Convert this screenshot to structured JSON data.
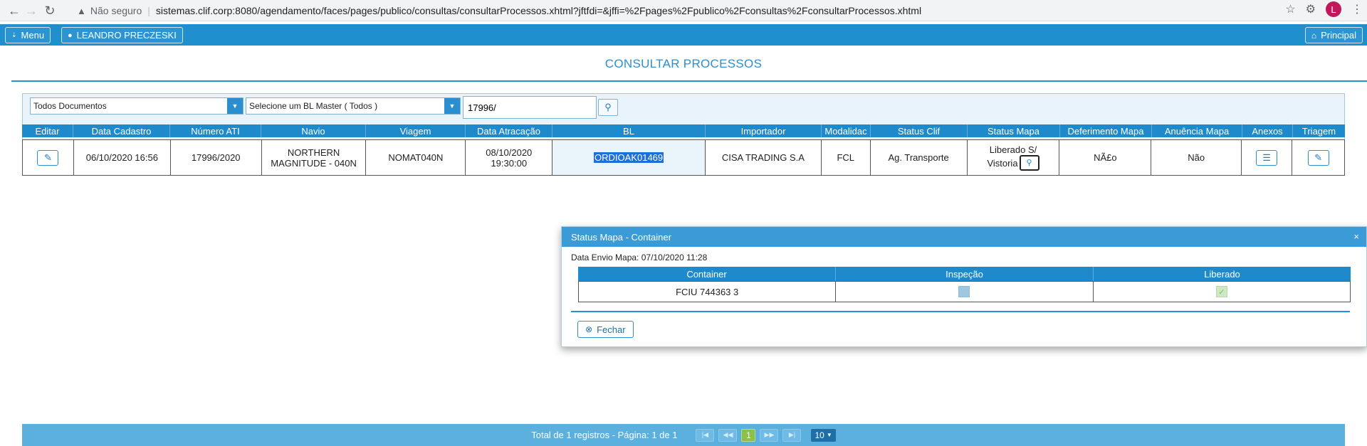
{
  "browser": {
    "security": "Não seguro",
    "url": "sistemas.clif.corp:8080/agendamento/faces/pages/publico/consultas/consultarProcessos.xhtml?jftfdi=&jffi=%2Fpages%2Fpublico%2Fconsultas%2FconsultarProcessos.xhtml",
    "avatar_letter": "L"
  },
  "appbar": {
    "menu_label": "Menu",
    "user_label": "LEANDRO PRECZESKI",
    "principal_label": "Principal"
  },
  "page": {
    "title": "CONSULTAR PROCESSOS"
  },
  "filters": {
    "doc_type": "Todos Documentos",
    "bl_master": "Selecione um BL Master ( Todos )",
    "search_value": "17996/"
  },
  "grid": {
    "columns": [
      "Editar",
      "Data Cadastro",
      "Número ATI",
      "Navio",
      "Viagem",
      "Data Atracação",
      "BL",
      "Importador",
      "Modalidac",
      "Status Clif",
      "Status Mapa",
      "Deferimento Mapa",
      "Anuência Mapa",
      "Anexos",
      "Triagem"
    ],
    "row": {
      "data_cadastro": "06/10/2020 16:56",
      "numero_ati": "17996/2020",
      "navio_line1": "NORTHERN",
      "navio_line2": "MAGNITUDE - 040N",
      "viagem": "NOMAT040N",
      "atracacao_line1": "08/10/2020",
      "atracacao_line2": "19:30:00",
      "bl": "ORDIOAK01469",
      "importador": "CISA TRADING S.A",
      "modalidade": "FCL",
      "status_clif": "Ag. Transporte",
      "status_mapa_line1": "Liberado S/",
      "status_mapa_line2": "Vistoria",
      "deferimento": "NÃ£o",
      "anuencia": "Não"
    }
  },
  "dialog": {
    "title": "Status Mapa - Container",
    "close": "×",
    "info": "Data Envio Mapa: 07/10/2020 11:28",
    "columns": [
      "Container",
      "Inspeção",
      "Liberado"
    ],
    "row": {
      "container": "FCIU 744363 3",
      "inspecao": false,
      "liberado": true
    },
    "fechar_label": "Fechar"
  },
  "pager": {
    "summary": "Total de 1 registros - Página: 1 de 1",
    "current_page": "1",
    "rows_per_page": "10"
  },
  "colors": {
    "primary": "#1f8fce",
    "accent_title": "#2a8fd0",
    "pager_bg": "#5cb0de",
    "page_active": "#8cc04a"
  }
}
